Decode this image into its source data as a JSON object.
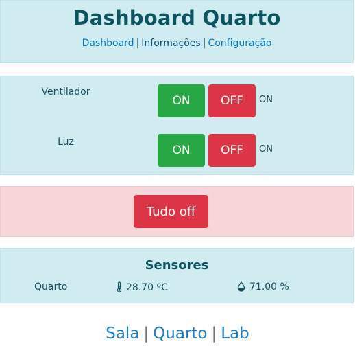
{
  "header": {
    "title": "Dashboard Quarto",
    "nav": [
      {
        "label": "Dashboard"
      },
      {
        "label": "Informações"
      },
      {
        "label": "Configuração"
      }
    ],
    "separator": "|"
  },
  "controls": {
    "devices": [
      {
        "name": "Ventilador",
        "on_label": "ON",
        "off_label": "OFF",
        "state": "ON"
      },
      {
        "name": "Luz",
        "on_label": "ON",
        "off_label": "OFF",
        "state": "ON"
      }
    ]
  },
  "all_off": {
    "label": "Tudo off"
  },
  "sensors": {
    "heading": "Sensores",
    "room": "Quarto",
    "temperature": "28.70 ºC",
    "humidity": "71.00 %"
  },
  "footer": {
    "links": [
      {
        "label": "Sala"
      },
      {
        "label": "Quarto"
      },
      {
        "label": "Lab"
      }
    ],
    "separator": "|"
  },
  "colors": {
    "info_bg": "#d1ecf1",
    "danger_bg": "#f8d7da",
    "on_button": "#28a745",
    "off_button": "#dc3545",
    "link": "#0079c8"
  },
  "icons": {
    "temperature": "thermometer-icon",
    "humidity": "droplet-icon"
  }
}
